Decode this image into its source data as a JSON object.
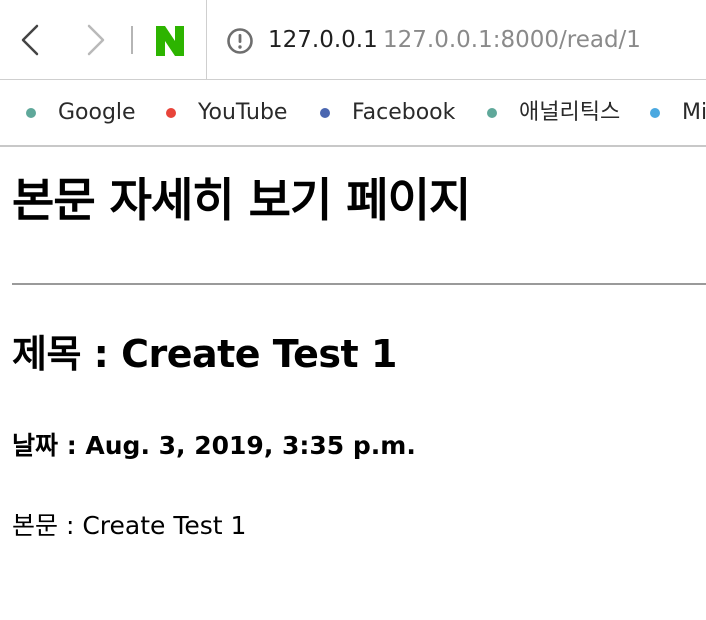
{
  "browser": {
    "url_host": "127.0.0.1",
    "url_full": "127.0.0.1:8000/read/1",
    "naver_logo_color": "#2db400"
  },
  "bookmarks": [
    {
      "label": "Google",
      "color": "#5fa89a"
    },
    {
      "label": "YouTube",
      "color": "#e8443a"
    },
    {
      "label": "Facebook",
      "color": "#4a66b0"
    },
    {
      "label": "애널리틱스",
      "color": "#5fa89a"
    },
    {
      "label": "Mi",
      "color": "#4aa8e0"
    }
  ],
  "page": {
    "title": "본문 자세히 보기 페이지",
    "post_title": "제목 : Create Test 1",
    "post_date": "날짜 : Aug. 3, 2019, 3:35 p.m.",
    "post_body": "본문 : Create Test 1"
  }
}
